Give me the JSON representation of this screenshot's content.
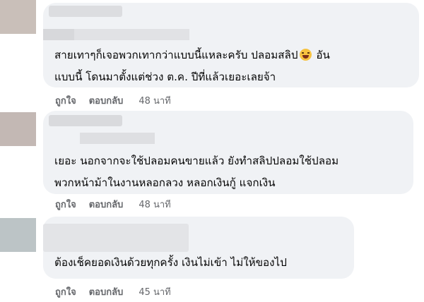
{
  "comments": [
    {
      "text_line_1": "สายเทาๆก็เจอพวกเทากว่าแบบนี้แหละครับ ปลอมสลิป",
      "text_line_1_tail": " อัน",
      "text_line_2": "แบบนี้ โดนมาตั้งแต่ช่วง ต.ค. ปีที่แล้วเยอะเลยจ้า",
      "like_label": "ถูกใจ",
      "reply_label": "ตอบกลับ",
      "time": "48 นาที",
      "emoji": "laughing-tears-emoji"
    },
    {
      "text_line_1": "เยอะ นอกจากจะใช้ปลอมคนขายแล้ว ยังทำสลิปปลอมใช้ปลอม",
      "text_line_2": "พวกหน้าม้าในงานหลอกลวง หลอกเงินกู้ แจกเงิน",
      "like_label": "ถูกใจ",
      "reply_label": "ตอบกลับ",
      "time": "48 นาที"
    },
    {
      "text_line_1": "ต้องเช็คยอดเงินด้วยทุกครั้ง เงินไม่เข้า ไม่ให้ของไป",
      "like_label": "ถูกใจ",
      "reply_label": "ตอบกลับ",
      "time": "45 นาที"
    }
  ],
  "colors": {
    "bubble": "#f0f2f5",
    "text": "#050505",
    "meta": "#65676b"
  }
}
